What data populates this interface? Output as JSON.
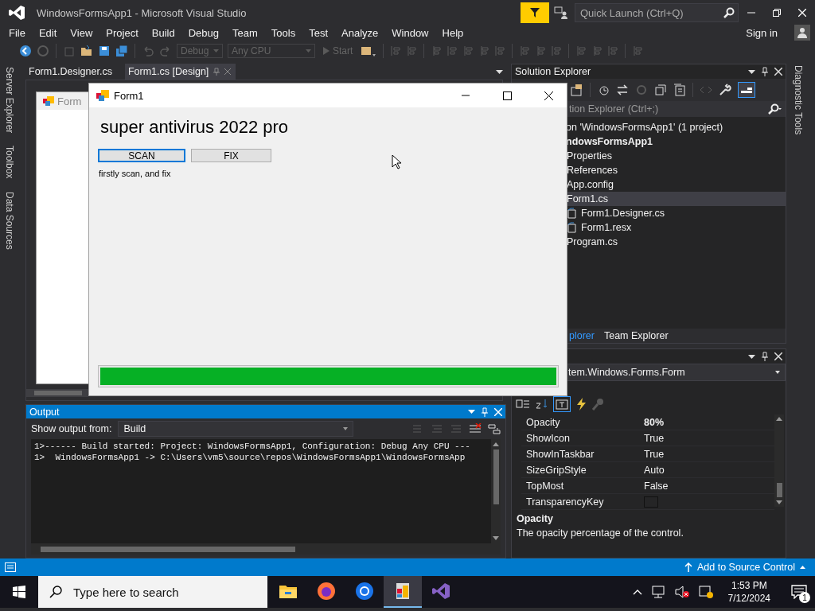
{
  "window": {
    "title": "WindowsFormsApp1 - Microsoft Visual Studio"
  },
  "quick_launch": {
    "placeholder": "Quick Launch (Ctrl+Q)"
  },
  "menu": [
    "File",
    "Edit",
    "View",
    "Project",
    "Build",
    "Debug",
    "Team",
    "Tools",
    "Test",
    "Analyze",
    "Window",
    "Help"
  ],
  "sign_in": "Sign in",
  "toolbar": {
    "configuration": "Debug",
    "platform": "Any CPU",
    "start": "Start"
  },
  "left_tabs": [
    "Server Explorer",
    "Toolbox",
    "Data Sources"
  ],
  "right_tabs": [
    "Diagnostic Tools"
  ],
  "document_tabs": [
    {
      "label": "Form1.Designer.cs",
      "selected": false
    },
    {
      "label": "Form1.cs [Design]",
      "selected": true
    }
  ],
  "designer": {
    "form_caption": "Form"
  },
  "form_window": {
    "title": "Form1",
    "heading": "super antivirus 2022 pro",
    "buttons": [
      {
        "label": "SCAN",
        "focused": true
      },
      {
        "label": "FIX",
        "focused": false
      }
    ],
    "hint": "firstly scan, and fix",
    "progress": {
      "level": 1
    }
  },
  "solution_explorer": {
    "title": "Solution Explorer",
    "search": {
      "placeholder": "tion Explorer (Ctrl+;)"
    },
    "tree": [
      {
        "label": "on 'WindowsFormsApp1' (1 project)",
        "kind": "solution",
        "selected": false,
        "children": [
          {
            "label": "ndowsFormsApp1",
            "kind": "project",
            "selected": false,
            "children": [
              {
                "label": "Properties",
                "kind": "folder",
                "selected": false
              },
              {
                "label": "References",
                "kind": "folder",
                "selected": false
              },
              {
                "label": "App.config",
                "kind": "folder",
                "selected": false
              },
              {
                "label": "Form1.cs",
                "kind": "folder",
                "selected": true,
                "children": [
                  {
                    "label": "Form1.Designer.cs",
                    "kind": "file",
                    "selected": false
                  },
                  {
                    "label": "Form1.resx",
                    "kind": "file",
                    "selected": false
                  }
                ]
              },
              {
                "label": "Program.cs",
                "kind": "folder",
                "selected": false
              }
            ]
          }
        ]
      }
    ],
    "tabs": [
      {
        "label": "plorer",
        "selected": true
      },
      {
        "label": "Team Explorer",
        "selected": false
      }
    ]
  },
  "properties": {
    "object": "tem.Windows.Forms.Form",
    "rows": [
      {
        "name": "Opacity",
        "value": "80%",
        "kind": "text",
        "modified": true
      },
      {
        "name": "ShowIcon",
        "value": "True",
        "kind": "text",
        "modified": false
      },
      {
        "name": "ShowInTaskbar",
        "value": "True",
        "kind": "text",
        "modified": false
      },
      {
        "name": "SizeGripStyle",
        "value": "Auto",
        "kind": "text",
        "modified": false
      },
      {
        "name": "TopMost",
        "value": "False",
        "kind": "text",
        "modified": false
      },
      {
        "name": "TransparencyKey",
        "kind": "color",
        "modified": false
      }
    ],
    "description": {
      "title": "Opacity",
      "text": "The opacity percentage of the control."
    }
  },
  "output": {
    "title": "Output",
    "source_label": "Show output from:",
    "source": "Build",
    "lines": [
      "1>------ Build started: Project: WindowsFormsApp1, Configuration: Debug Any CPU ---",
      "1>  WindowsFormsApp1 -> C:\\Users\\vm5\\source\\repos\\WindowsFormsApp1\\WindowsFormsApp"
    ]
  },
  "status_bar": {
    "source_control": "Add to Source Control"
  },
  "taskbar": {
    "search": {
      "placeholder": "Type here to search"
    },
    "apps": [
      {
        "kind": "files",
        "selected": false
      },
      {
        "kind": "firefox",
        "selected": false
      },
      {
        "kind": "chrome",
        "selected": false
      },
      {
        "kind": "winform",
        "selected": true
      },
      {
        "kind": "ide",
        "selected": false
      }
    ],
    "time": "1:53 PM",
    "date": "7/12/2024",
    "notifications": "1"
  }
}
